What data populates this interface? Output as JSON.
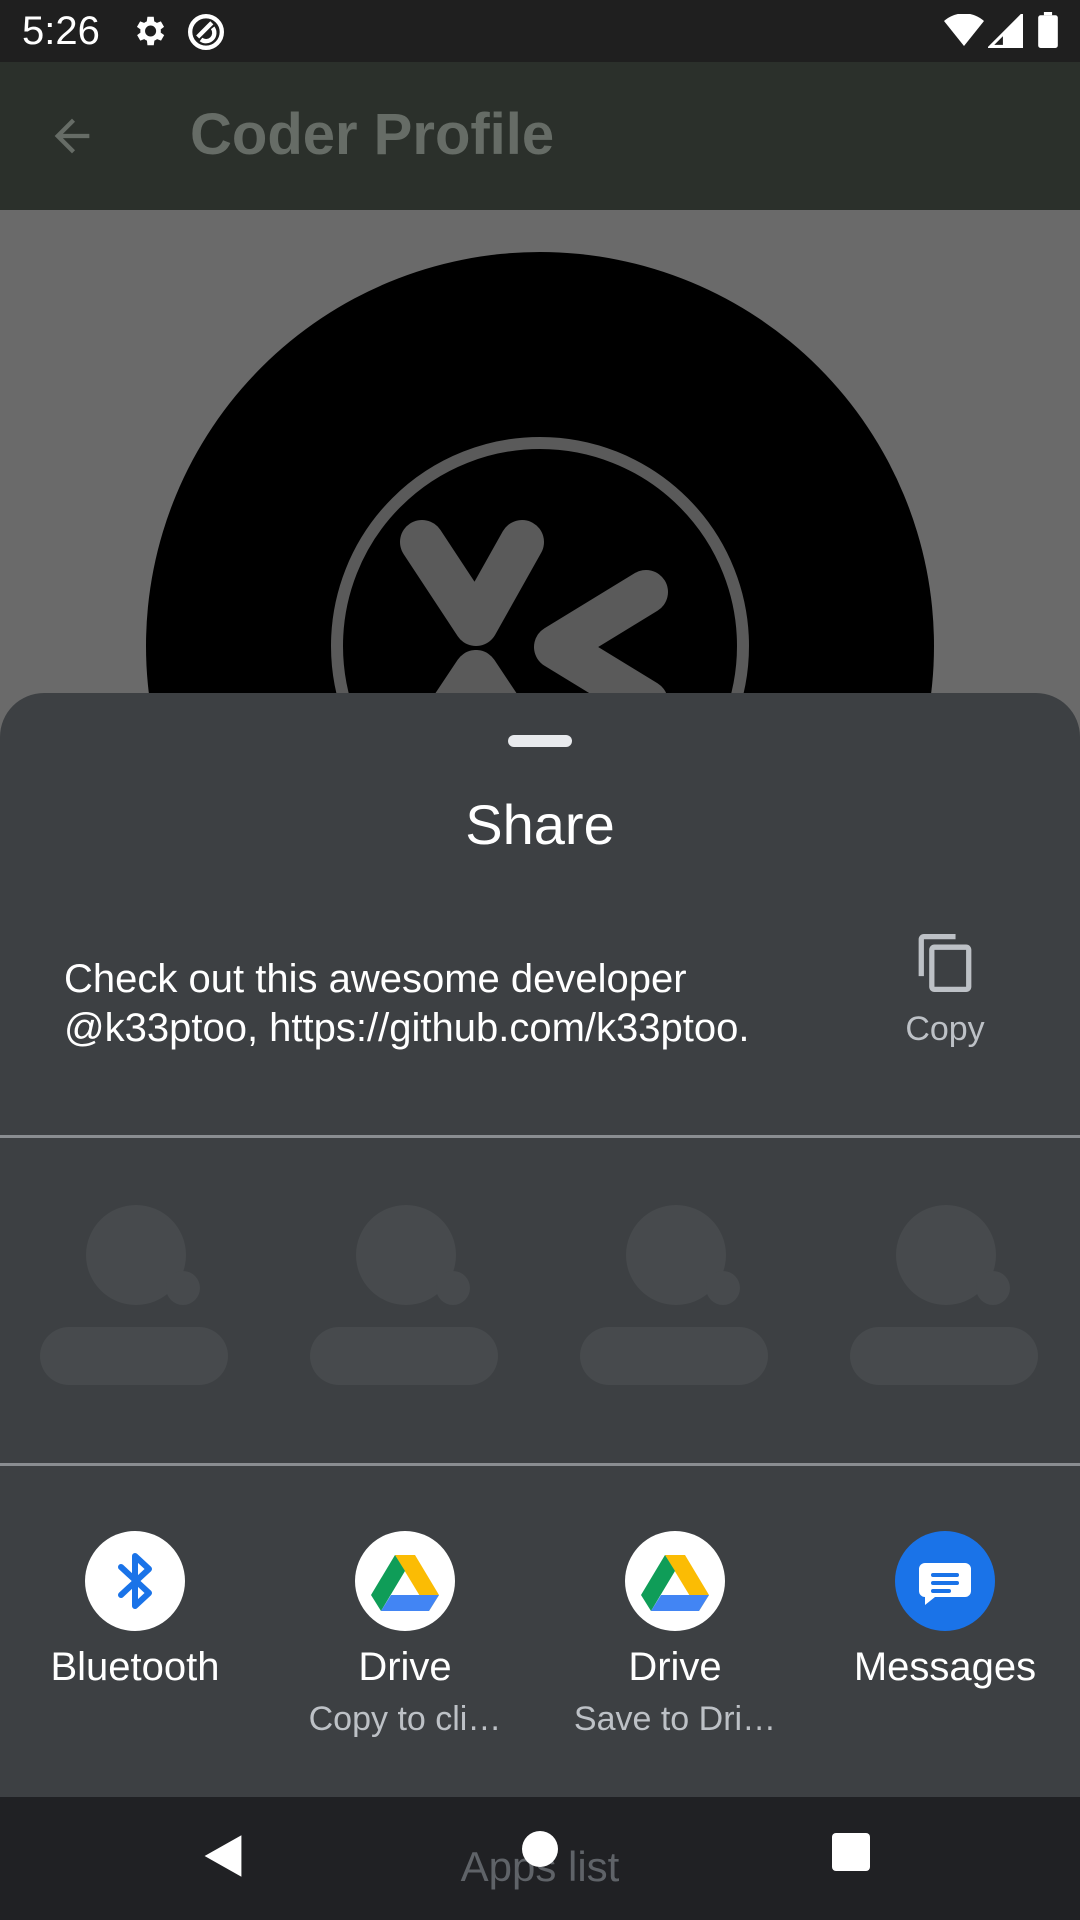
{
  "status_bar": {
    "time": "5:26",
    "icons": [
      "settings-icon",
      "do-not-disturb-icon",
      "wifi-icon",
      "signal-icon",
      "battery-icon"
    ]
  },
  "app_bar": {
    "title": "Coder Profile",
    "back_icon": "arrow-back-icon"
  },
  "share_sheet": {
    "title": "Share",
    "share_text": "Check out this awesome developer @k33ptoo, https://github.com/k33ptoo.",
    "copy_label": "Copy",
    "targets": [
      {
        "label": "Bluetooth",
        "sublabel": "",
        "icon": "bluetooth-icon"
      },
      {
        "label": "Drive",
        "sublabel": "Copy to cli…",
        "icon": "google-drive-icon"
      },
      {
        "label": "Drive",
        "sublabel": "Save to Dri…",
        "icon": "google-drive-icon"
      },
      {
        "label": "Messages",
        "sublabel": "",
        "icon": "messages-icon"
      }
    ]
  },
  "nav_bar": {
    "overlay_text": "Apps list"
  },
  "colors": {
    "sheet_bg": "#3d4043",
    "bluetooth_blue": "#1a73e8",
    "messages_blue": "#1a73e8"
  }
}
